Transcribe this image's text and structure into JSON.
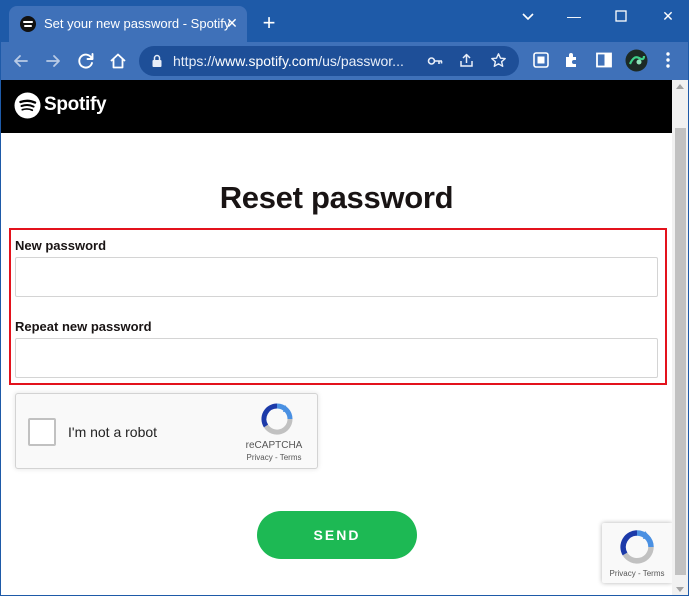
{
  "browser": {
    "tab_title": "Set your new password - Spotify",
    "tab_close": "✕",
    "new_tab": "+",
    "window_controls": {
      "minimize": "—",
      "maximize": "☐",
      "close": "✕"
    },
    "url_prefix": "https://",
    "url_domain": "www.spotify.com",
    "url_path": "/us/passwor..."
  },
  "site": {
    "brand": "Spotify"
  },
  "form": {
    "heading": "Reset password",
    "new_password_label": "New password",
    "new_password_value": "",
    "repeat_password_label": "Repeat new password",
    "repeat_password_value": ""
  },
  "recaptcha": {
    "label": "I'm not a robot",
    "brand": "reCAPTCHA",
    "links": "Privacy - Terms",
    "checked": false
  },
  "send_button": "SEND",
  "recaptcha_badge": {
    "links": "Privacy - Terms"
  },
  "colors": {
    "chrome_frame": "#1e5aa8",
    "chrome_tab": "#3f71b9",
    "spotify_green": "#1db954",
    "highlight_red": "#e3121c"
  }
}
